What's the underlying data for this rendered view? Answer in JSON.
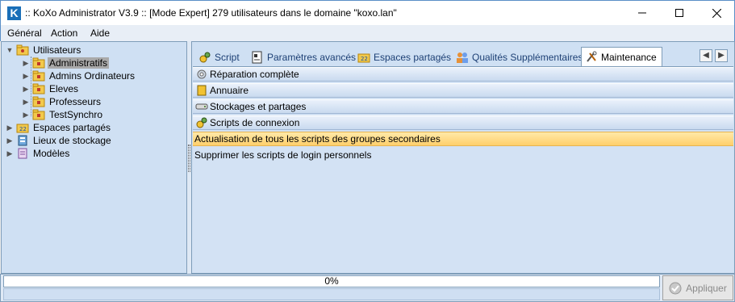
{
  "window": {
    "title": ":: KoXo Administrator V3.9 :: [Mode Expert] 279 utilisateurs dans le domaine \"koxo.lan\"",
    "logo_letter": "K"
  },
  "menu": {
    "items": [
      "Général",
      "Action",
      "Aide"
    ]
  },
  "tree": {
    "users": "Utilisateurs",
    "children": [
      "Administratifs",
      "Admins Ordinateurs",
      "Eleves",
      "Professeurs",
      "TestSynchro"
    ],
    "selected": "Administratifs",
    "shared": "Espaces partagés",
    "storage": "Lieux de stockage",
    "models": "Modèles"
  },
  "tabs": {
    "script": "Script",
    "advanced": "Paramètres avancés",
    "shared": "Espaces partagés",
    "qualities": "Qualités Supplémentaires",
    "maintenance": "Maintenance",
    "active": "Maintenance"
  },
  "maintenance": {
    "repair": "Réparation complète",
    "directory": "Annuaire",
    "storage": "Stockages et partages",
    "login_scripts": "Scripts de connexion",
    "action_update": "Actualisation de tous les scripts des groupes secondaires",
    "action_delete": "Supprimer les scripts de login personnels"
  },
  "status": {
    "progress": 0,
    "progress_text": "0%",
    "apply_label": "Appliquer"
  },
  "colors": {
    "accent": "#1a6fb8",
    "highlight": "#ffcf6b",
    "panel": "#cfe0f3"
  }
}
